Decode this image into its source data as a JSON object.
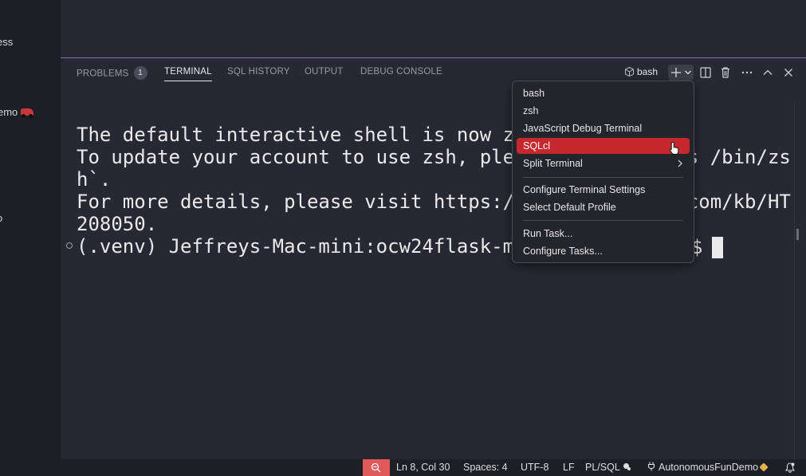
{
  "sidebar": {
    "items": [
      {
        "label": "ess"
      },
      {
        "label": "emo"
      },
      {
        "label": "o"
      }
    ]
  },
  "panel": {
    "tabs": [
      {
        "label": "PROBLEMS",
        "badge": "1"
      },
      {
        "label": "TERMINAL",
        "active": true
      },
      {
        "label": "SQL HISTORY"
      },
      {
        "label": "OUTPUT"
      },
      {
        "label": "DEBUG CONSOLE"
      }
    ],
    "terminal_selector": {
      "label": "bash",
      "icon": "terminal-icon"
    },
    "actions": [
      "new-terminal-icon",
      "dropdown-chevron-icon",
      "split-icon",
      "trash-icon",
      "more-icon",
      "maximize-icon",
      "close-icon"
    ]
  },
  "terminal": {
    "lines": [
      "The default interactive shell is now zsh.",
      "To update your account to use zsh, please run `chsh -s /bin/zs",
      "h`.",
      "For more details, please visit https://support.apple.com/kb/HT",
      "208050.",
      "(.venv) Jeffreys-Mac-mini:ocw24flask-ma"
    ],
    "prompt_suffix": "$"
  },
  "menu": {
    "items": [
      {
        "label": "bash"
      },
      {
        "label": "zsh"
      },
      {
        "label": "JavaScript Debug Terminal"
      },
      {
        "label": "SQLcl",
        "selected": true
      },
      {
        "label": "Split Terminal",
        "submenu": true
      }
    ],
    "group2": [
      {
        "label": "Configure Terminal Settings"
      },
      {
        "label": "Select Default Profile"
      }
    ],
    "group3": [
      {
        "label": "Run Task..."
      },
      {
        "label": "Configure Tasks..."
      }
    ]
  },
  "statusbar": {
    "position": "Ln 8, Col 30",
    "spaces": "Spaces: 4",
    "encoding": "UTF-8",
    "eol": "LF",
    "language": "PL/SQL",
    "connection": "AutonomousFunDemo",
    "accent_color": "#e05a5a"
  },
  "colors": {
    "panel_bg": "#272833",
    "selected_item": "#c5292e",
    "active_border": "#8c6ab8"
  }
}
